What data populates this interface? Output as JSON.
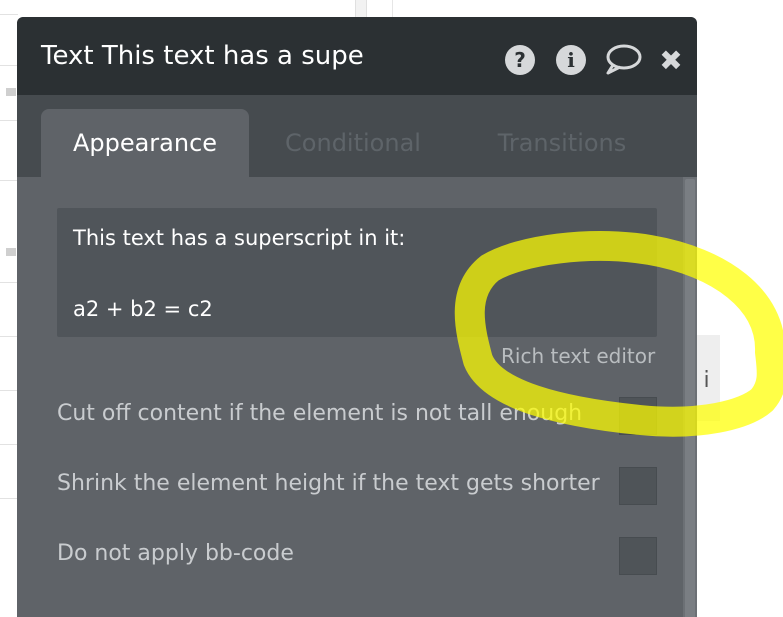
{
  "panel": {
    "title": "Text This text has a supe",
    "header_icons": [
      "help-icon",
      "info-icon",
      "comment-icon",
      "close-icon"
    ],
    "help_glyph": "?",
    "info_glyph": "i",
    "close_glyph": "✖"
  },
  "tabs": [
    {
      "label": "Appearance",
      "active": true
    },
    {
      "label": "Conditional",
      "active": false
    },
    {
      "label": "Transitions",
      "active": false
    }
  ],
  "text_content": {
    "line1": "This text has a superscript in it:",
    "line2": "a2 + b2 = c2"
  },
  "rich_text_editor_label": "Rich text editor",
  "options": [
    {
      "label": "Cut off content if the element is not tall enough",
      "checked": false
    },
    {
      "label": "Shrink the element height if the text gets shorter",
      "checked": false
    },
    {
      "label": "Do not apply bb-code",
      "checked": false
    }
  ],
  "background": {
    "partial_text": "o i"
  },
  "colors": {
    "header": "#2b3033",
    "panel": "#5f6368",
    "highlight": "#ffff00"
  }
}
